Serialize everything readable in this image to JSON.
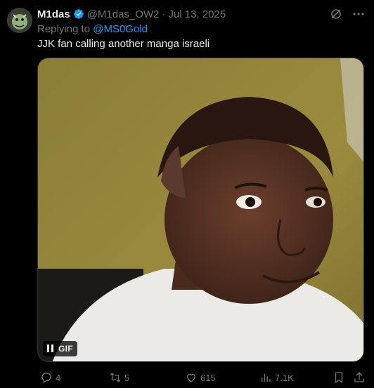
{
  "tweet": {
    "author_name": "M1das",
    "author_handle": "@M1das_OW2",
    "separator": "·",
    "date": "Jul 13, 2025",
    "replying_prefix": "Replying to",
    "replying_to": "@MS0Gold",
    "text": "JJK fan calling another manga israeli"
  },
  "media": {
    "gif_label": "GIF"
  },
  "actions": {
    "replies": "4",
    "retweets": "5",
    "likes": "615",
    "views": "7.1K"
  },
  "colors": {
    "accent": "#1d9bf0",
    "muted": "#71767b",
    "text": "#e7e9ea",
    "background": "#000000"
  }
}
